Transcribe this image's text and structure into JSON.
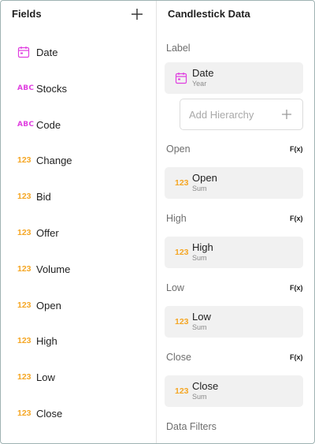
{
  "fields_panel": {
    "title": "Fields",
    "items": [
      {
        "type": "date",
        "type_label": "",
        "label": "Date"
      },
      {
        "type": "text",
        "type_label": "ABC",
        "label": "Stocks"
      },
      {
        "type": "text",
        "type_label": "ABC",
        "label": "Code"
      },
      {
        "type": "number",
        "type_label": "123",
        "label": "Change"
      },
      {
        "type": "number",
        "type_label": "123",
        "label": "Bid"
      },
      {
        "type": "number",
        "type_label": "123",
        "label": "Offer"
      },
      {
        "type": "number",
        "type_label": "123",
        "label": "Volume"
      },
      {
        "type": "number",
        "type_label": "123",
        "label": "Open"
      },
      {
        "type": "number",
        "type_label": "123",
        "label": "High"
      },
      {
        "type": "number",
        "type_label": "123",
        "label": "Low"
      },
      {
        "type": "number",
        "type_label": "123",
        "label": "Close"
      }
    ]
  },
  "data_panel": {
    "title": "Candlestick Data",
    "label_section": {
      "title": "Label",
      "chip": {
        "name": "Date",
        "sub": "Year"
      },
      "add_hierarchy": "Add Hierarchy"
    },
    "open_section": {
      "title": "Open",
      "fx": "F(x)",
      "chip": {
        "type_label": "123",
        "name": "Open",
        "sub": "Sum"
      }
    },
    "high_section": {
      "title": "High",
      "fx": "F(x)",
      "chip": {
        "type_label": "123",
        "name": "High",
        "sub": "Sum"
      }
    },
    "low_section": {
      "title": "Low",
      "fx": "F(x)",
      "chip": {
        "type_label": "123",
        "name": "Low",
        "sub": "Sum"
      }
    },
    "close_section": {
      "title": "Close",
      "fx": "F(x)",
      "chip": {
        "type_label": "123",
        "name": "Close",
        "sub": "Sum"
      }
    },
    "data_filters_title": "Data Filters"
  },
  "colors": {
    "text_type": "#e040e0",
    "number_type": "#f5a623",
    "date_type": "#e040e0"
  }
}
